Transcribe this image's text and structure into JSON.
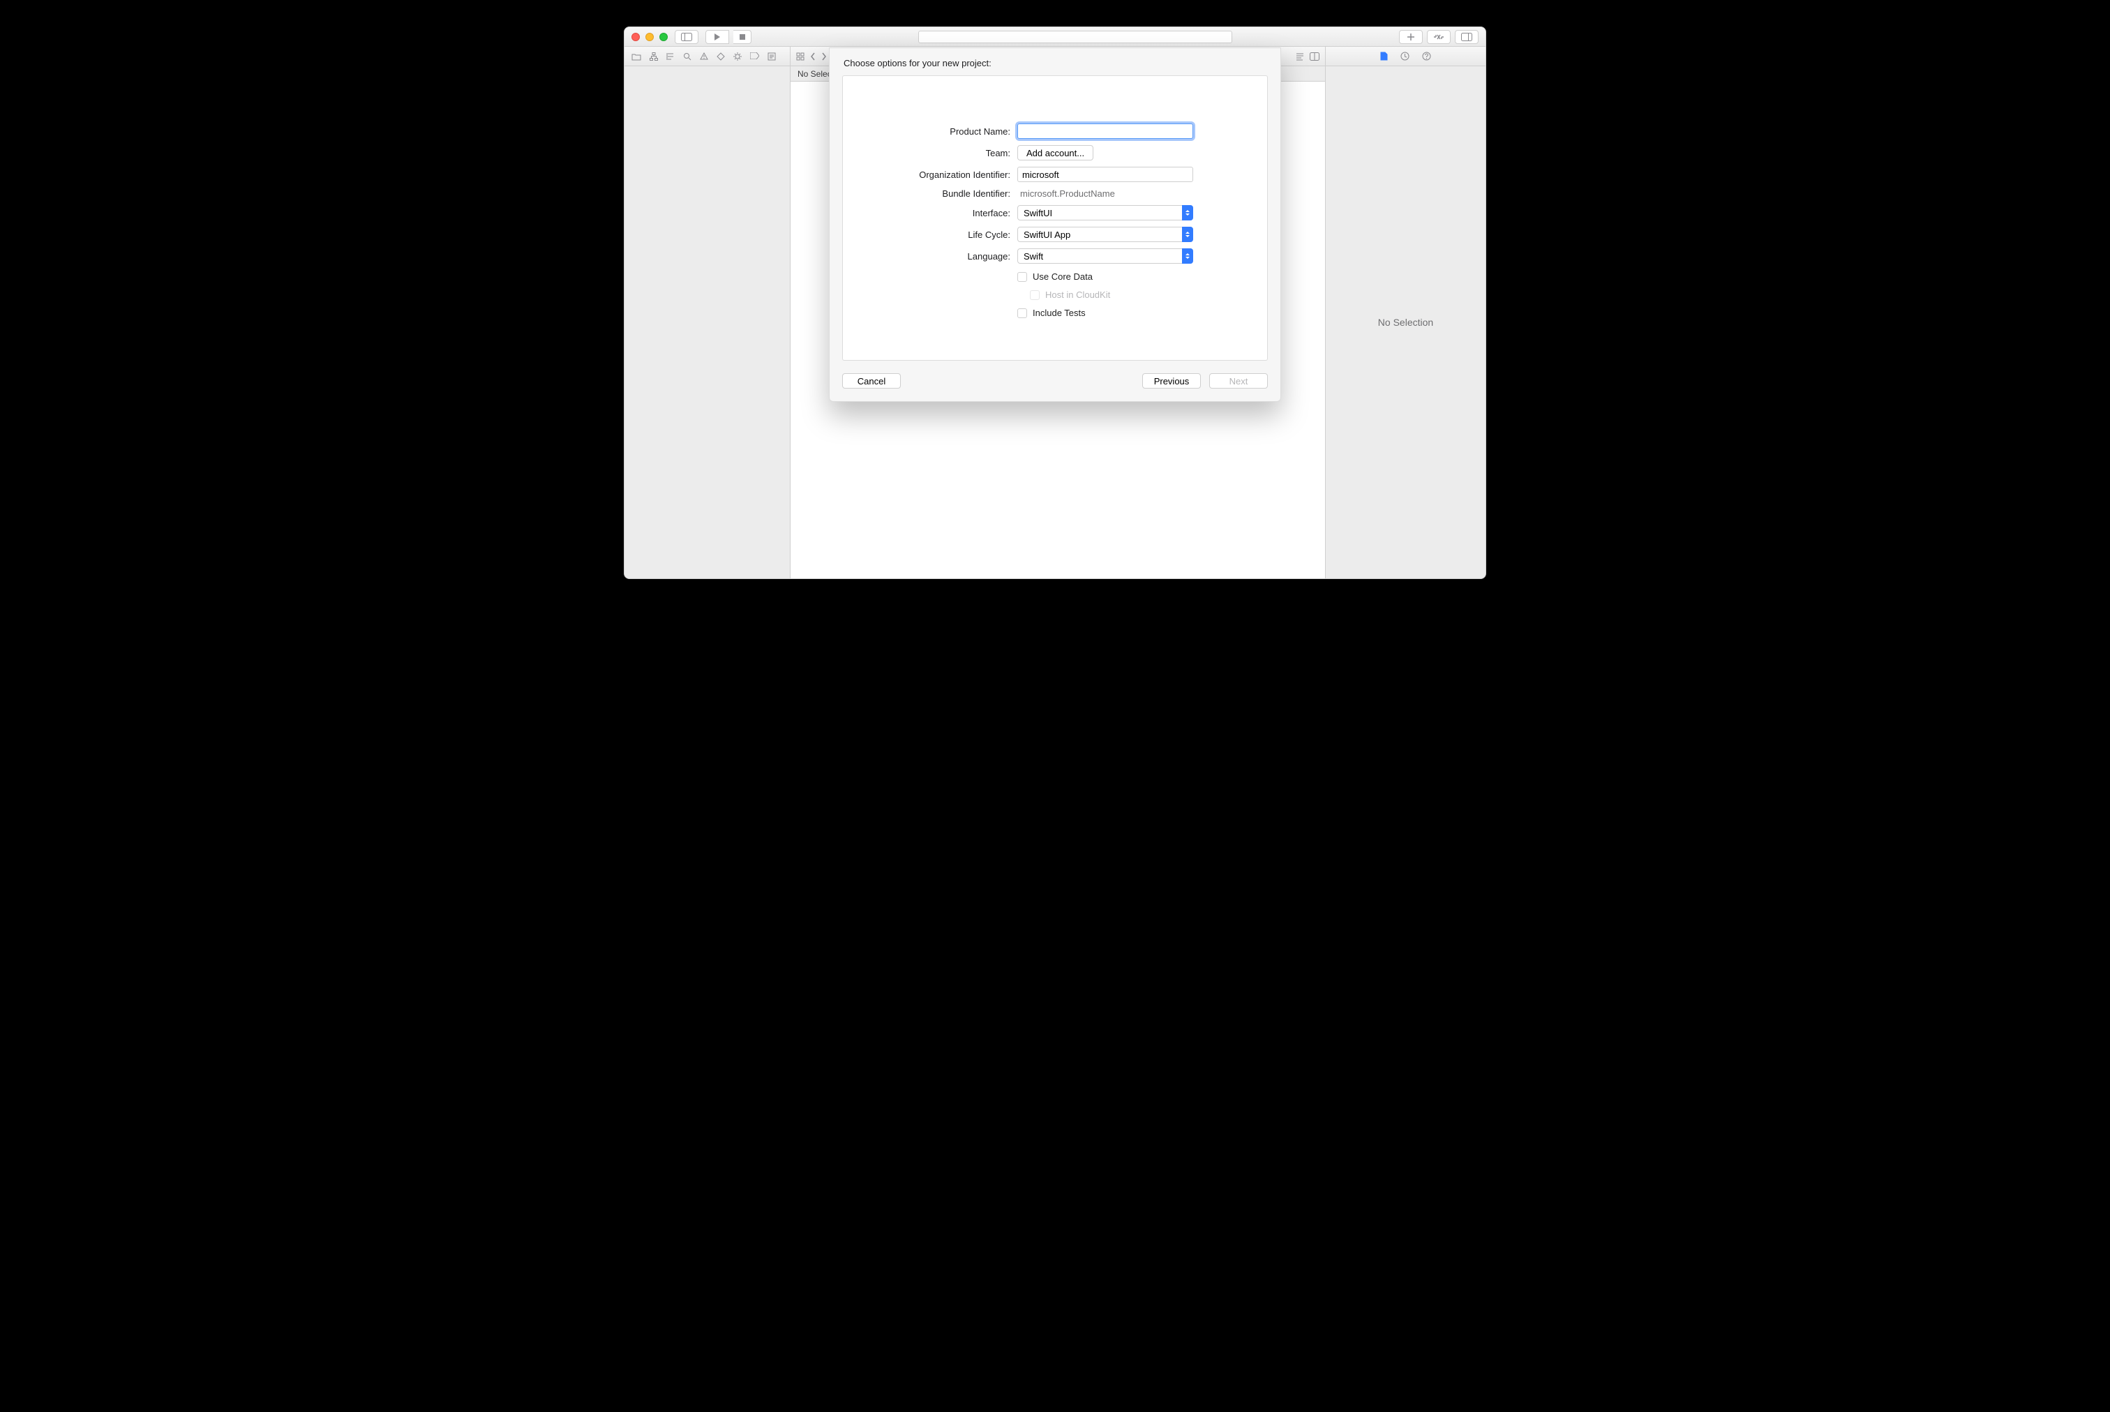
{
  "window": {
    "traffic": {
      "close": "close",
      "min": "minimize",
      "max": "zoom"
    }
  },
  "editor": {
    "no_selection_label": "No Selection"
  },
  "inspector": {
    "empty_label": "No Selection"
  },
  "sheet": {
    "title": "Choose options for your new project:",
    "fields": {
      "product_name": {
        "label": "Product Name:",
        "value": ""
      },
      "team": {
        "label": "Team:",
        "button": "Add account..."
      },
      "org_id": {
        "label": "Organization Identifier:",
        "value": "microsoft"
      },
      "bundle_id": {
        "label": "Bundle Identifier:",
        "value": "microsoft.ProductName"
      },
      "interface": {
        "label": "Interface:",
        "value": "SwiftUI"
      },
      "lifecycle": {
        "label": "Life Cycle:",
        "value": "SwiftUI App"
      },
      "language": {
        "label": "Language:",
        "value": "Swift"
      },
      "use_core_data": {
        "label": "Use Core Data",
        "checked": false
      },
      "host_cloudkit": {
        "label": "Host in CloudKit",
        "checked": false,
        "disabled": true
      },
      "include_tests": {
        "label": "Include Tests",
        "checked": false
      }
    },
    "buttons": {
      "cancel": "Cancel",
      "previous": "Previous",
      "next": "Next"
    }
  },
  "icons": {
    "sidebar": "sidebar-icon",
    "run": "play-icon",
    "stop": "stop-icon",
    "plus": "plus-icon",
    "review": "review-icon",
    "panels": "panels-icon",
    "folder": "folder-icon",
    "sourcecontrol": "source-control-icon",
    "symbol": "symbol-icon",
    "find": "find-icon",
    "issues": "issues-icon",
    "tests": "tests-icon",
    "debug": "debug-icon",
    "breakpoints": "breakpoints-icon",
    "reports": "reports-icon",
    "grid": "grid-icon",
    "back": "chevron-left-icon",
    "fwd": "chevron-right-icon",
    "minimap": "minimap-icon",
    "adjust": "adjust-icon",
    "file": "file-inspector-icon",
    "history": "history-inspector-icon",
    "help": "help-inspector-icon"
  }
}
